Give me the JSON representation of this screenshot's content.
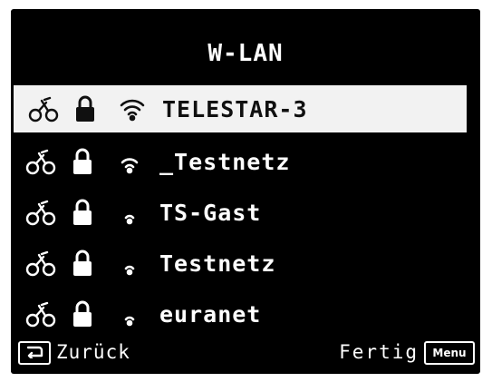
{
  "header": {
    "title": "W-LAN"
  },
  "networks": [
    {
      "ssid": "TELESTAR-3",
      "selected": true,
      "signal": "full",
      "icons": [
        "wps-icon",
        "lock-icon",
        "wifi-signal-icon"
      ]
    },
    {
      "ssid": "_Testnetz",
      "selected": false,
      "signal": "medium",
      "icons": [
        "wps-icon",
        "lock-icon",
        "wifi-signal-icon"
      ]
    },
    {
      "ssid": "TS-Gast",
      "selected": false,
      "signal": "low",
      "icons": [
        "wps-icon",
        "lock-icon",
        "wifi-signal-icon"
      ]
    },
    {
      "ssid": "Testnetz",
      "selected": false,
      "signal": "low",
      "icons": [
        "wps-icon",
        "lock-icon",
        "wifi-signal-icon"
      ]
    },
    {
      "ssid": "euranet",
      "selected": false,
      "signal": "low",
      "icons": [
        "wps-icon",
        "lock-icon",
        "wifi-signal-icon"
      ]
    }
  ],
  "footer": {
    "back_label": "Zurück",
    "done_label": "Fertig",
    "menu_key": "Menu"
  },
  "colors": {
    "background": "#000000",
    "text": "#ffffff",
    "highlight": "#f2f2f2"
  }
}
